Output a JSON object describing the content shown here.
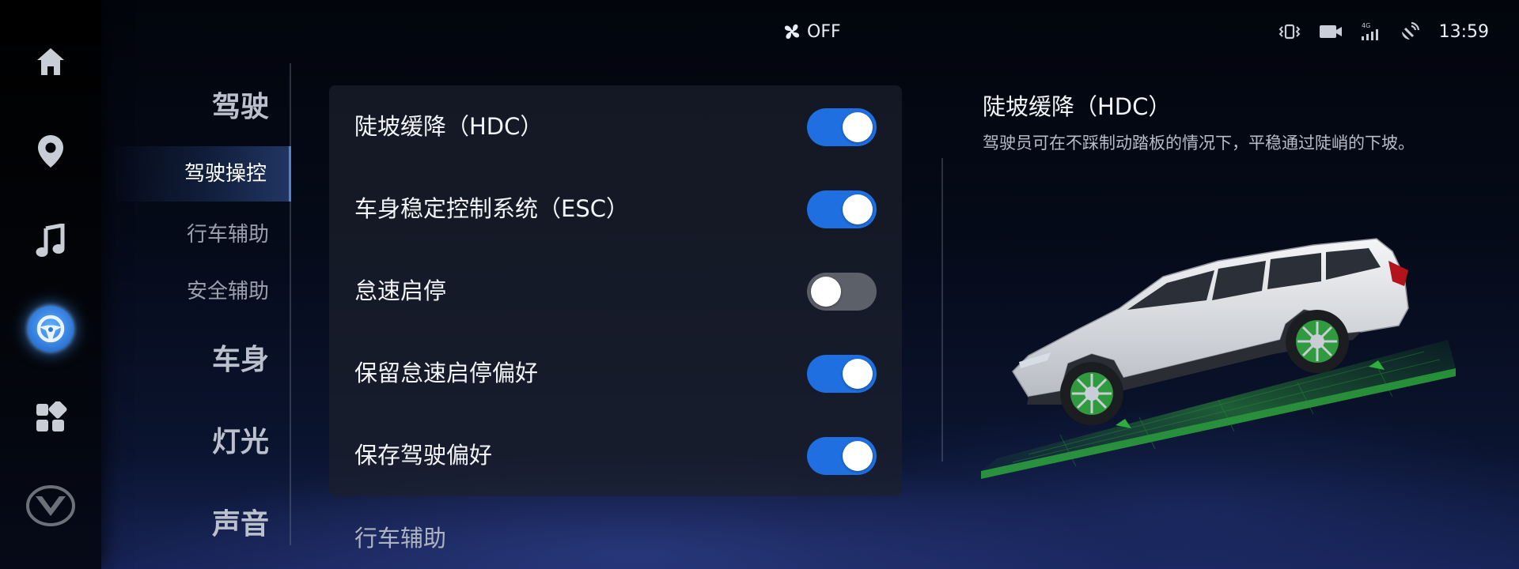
{
  "status_bar": {
    "ac_label": "OFF",
    "time": "13:59",
    "icons": [
      "fan-icon",
      "vibrate-icon",
      "camera-icon",
      "4g-signal-icon",
      "satellite-icon"
    ],
    "network_badge": "4G"
  },
  "dock": {
    "items": [
      {
        "name": "home",
        "icon": "home-icon"
      },
      {
        "name": "navigation",
        "icon": "location-pin-icon"
      },
      {
        "name": "music",
        "icon": "music-note-icon"
      },
      {
        "name": "vehicle-settings",
        "icon": "steering-wheel-icon",
        "active": true
      },
      {
        "name": "apps",
        "icon": "app-grid-icon"
      },
      {
        "name": "brand",
        "icon": "changan-logo-icon"
      }
    ]
  },
  "nav": {
    "categories": {
      "driving": "驾驶",
      "body": "车身",
      "lights": "灯光",
      "sound": "声音"
    },
    "sub": {
      "driving_control": "驾驶操控",
      "driving_assist": "行车辅助",
      "safety_assist": "安全辅助"
    },
    "active": "驾驶操控"
  },
  "settings": {
    "rows": [
      {
        "label": "陡坡缓降（HDC）",
        "enabled": true
      },
      {
        "label": "车身稳定控制系统（ESC）",
        "enabled": true
      },
      {
        "label": "怠速启停",
        "enabled": false
      },
      {
        "label": "保留怠速启停偏好",
        "enabled": true
      },
      {
        "label": "保存驾驶偏好",
        "enabled": true
      }
    ],
    "next_section": "行车辅助"
  },
  "detail": {
    "title": "陡坡缓降（HDC）",
    "description": "驾驶员可在不踩制动踏板的情况下，平稳通过陡峭的下坡。"
  },
  "colors": {
    "accent": "#1f6fe0",
    "toggle_off": "#5c6068",
    "highlight": "#2c74d6"
  }
}
